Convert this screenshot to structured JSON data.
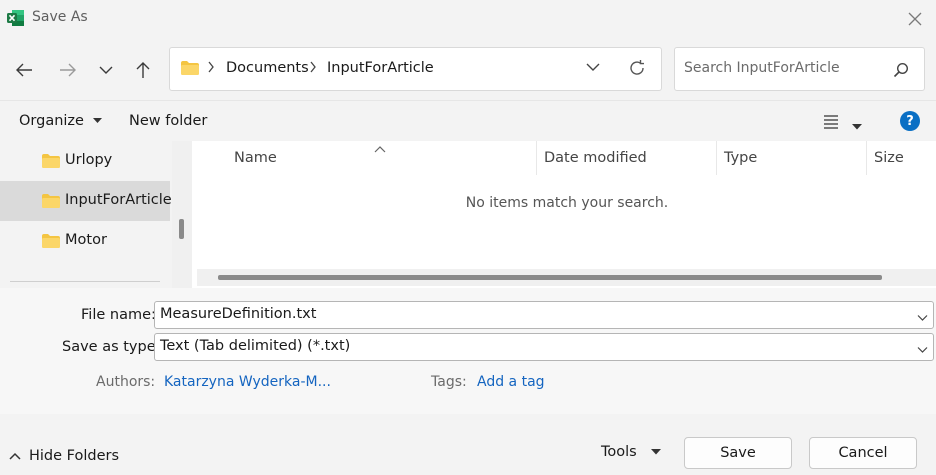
{
  "window": {
    "title": "Save As"
  },
  "address": {
    "crumbs": [
      "Documents",
      "InputForArticle"
    ]
  },
  "search": {
    "placeholder": "Search InputForArticle"
  },
  "toolbar": {
    "organize": "Organize",
    "new_folder": "New folder",
    "help": "?"
  },
  "tree": {
    "items": [
      "Urlopy",
      "InputForArticle",
      "Motor"
    ],
    "selected": "InputForArticle"
  },
  "list": {
    "columns": [
      "Name",
      "Date modified",
      "Type",
      "Size"
    ],
    "empty_message": "No items match your search."
  },
  "form": {
    "file_name_label": "File name:",
    "file_name_value": "MeasureDefinition.txt",
    "save_type_label": "Save as type:",
    "save_type_value": "Text (Tab delimited) (*.txt)",
    "authors_label": "Authors:",
    "authors_value": "Katarzyna Wyderka-M...",
    "tags_label": "Tags:",
    "tags_value": "Add a tag"
  },
  "footer": {
    "hide_folders": "Hide Folders",
    "tools": "Tools",
    "save": "Save",
    "cancel": "Cancel"
  },
  "colors": {
    "folder": "#f4c542",
    "accent": "#0a6fc4",
    "link": "#1565c0",
    "excel_green": "#1d7a45"
  }
}
